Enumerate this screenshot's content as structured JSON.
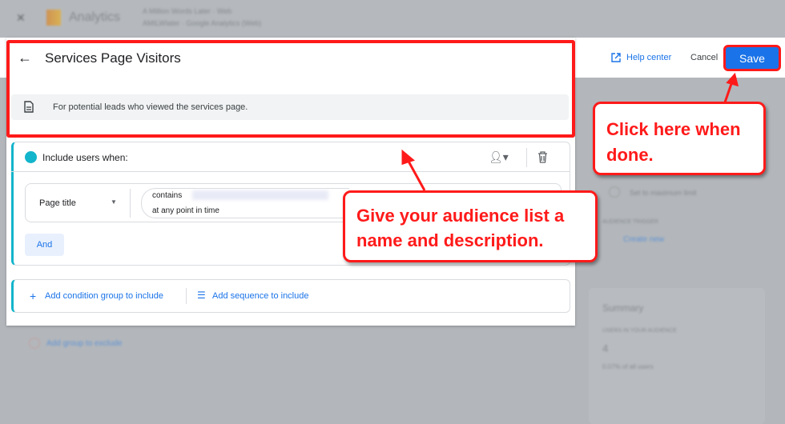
{
  "topbar": {
    "app_name": "Analytics",
    "account_line": "A Million Words Later · Web",
    "property_line": "AMILWlater · Google Analytics (Web)"
  },
  "header": {
    "title": "Services Page Visitors",
    "help_label": "Help center",
    "cancel_label": "Cancel",
    "save_label": "Save"
  },
  "description": "For potential leads who viewed the services page.",
  "group": {
    "title": "Include users when:",
    "dimension": "Page title",
    "operator": "contains",
    "scope": "at any point in time",
    "and_label": "And"
  },
  "add_row": {
    "condition_label": "Add condition group to include",
    "sequence_label": "Add sequence to include"
  },
  "background": {
    "exclude_label": "Add group to exclude",
    "set_duration": "Set to maximum limit",
    "triggers_label": "AUDIENCE TRIGGER",
    "create_new": "Create new",
    "summary_title": "Summary",
    "summary_users_label": "USERS IN YOUR AUDIENCE",
    "summary_users": "4",
    "summary_pct": "0.07% of all users"
  },
  "callouts": {
    "save": "Click here when done.",
    "name": "Give your audience list a name and description."
  }
}
